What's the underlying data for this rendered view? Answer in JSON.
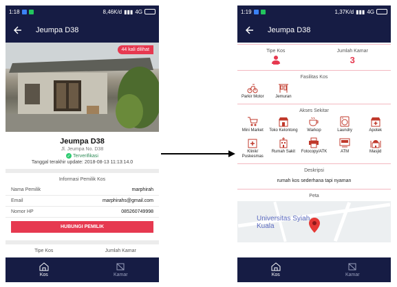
{
  "left": {
    "status": {
      "time": "1:18",
      "speed": "8,46K/d",
      "network": "4G"
    },
    "appbar": {
      "title": "Jeumpa D38"
    },
    "views_badge": "44 kali dilihat",
    "kos": {
      "name": "Jeumpa D38",
      "address": "Jl. Jeumpa No. D38",
      "verified": "Terverifikasi",
      "updated": "Tanggal terakhir update: 2018-08-13 11:13:14.0"
    },
    "owner_section": {
      "title": "Informasi Pemilik Kos",
      "rows": [
        {
          "label": "Nama Pemilik",
          "value": "marphirah"
        },
        {
          "label": "Email",
          "value": "marphirahs@gmail.com"
        },
        {
          "label": "Nomor HP",
          "value": "085260749998"
        }
      ],
      "contact_button": "HUBUNGI PEMILIK"
    },
    "type_label": "Tipe Kos",
    "rooms_label": "Jumlah Kamar",
    "nav": {
      "kos": "Kos",
      "kamar": "Kamar"
    }
  },
  "right": {
    "status": {
      "time": "1:19",
      "speed": "1,37K/d",
      "network": "4G"
    },
    "appbar": {
      "title": "Jeumpa D38"
    },
    "type_label": "Tipe Kos",
    "rooms_label": "Jumlah Kamar",
    "rooms_value": "3",
    "facilities": {
      "title": "Fasilitas Kos",
      "items": [
        {
          "label": "Parkir Motor",
          "icon": "motorbike-icon"
        },
        {
          "label": "Jemuran",
          "icon": "clothesline-icon"
        }
      ]
    },
    "access": {
      "title": "Akses Sekitar",
      "items": [
        {
          "label": "Mini Market",
          "icon": "cart-icon"
        },
        {
          "label": "Toko Kelontong",
          "icon": "shop-icon"
        },
        {
          "label": "Warkop",
          "icon": "coffee-icon"
        },
        {
          "label": "Laundry",
          "icon": "laundry-icon"
        },
        {
          "label": "Apotek",
          "icon": "pharmacy-icon"
        },
        {
          "label": "Klinik/ Puskesmas",
          "icon": "clinic-icon"
        },
        {
          "label": "Rumah Sakit",
          "icon": "hospital-icon"
        },
        {
          "label": "Fotocopy/ATK",
          "icon": "printer-icon"
        },
        {
          "label": "ATM",
          "icon": "atm-icon"
        },
        {
          "label": "Masjid",
          "icon": "mosque-icon"
        }
      ]
    },
    "description": {
      "title": "Deskripsi",
      "text": "rumah kos sederhana tapi nyaman"
    },
    "map": {
      "title": "Peta",
      "label": "Universitas Syiah Kuala"
    },
    "nav": {
      "kos": "Kos",
      "kamar": "Kamar"
    }
  },
  "colors": {
    "primary": "#161c44",
    "accent": "#e63950"
  }
}
